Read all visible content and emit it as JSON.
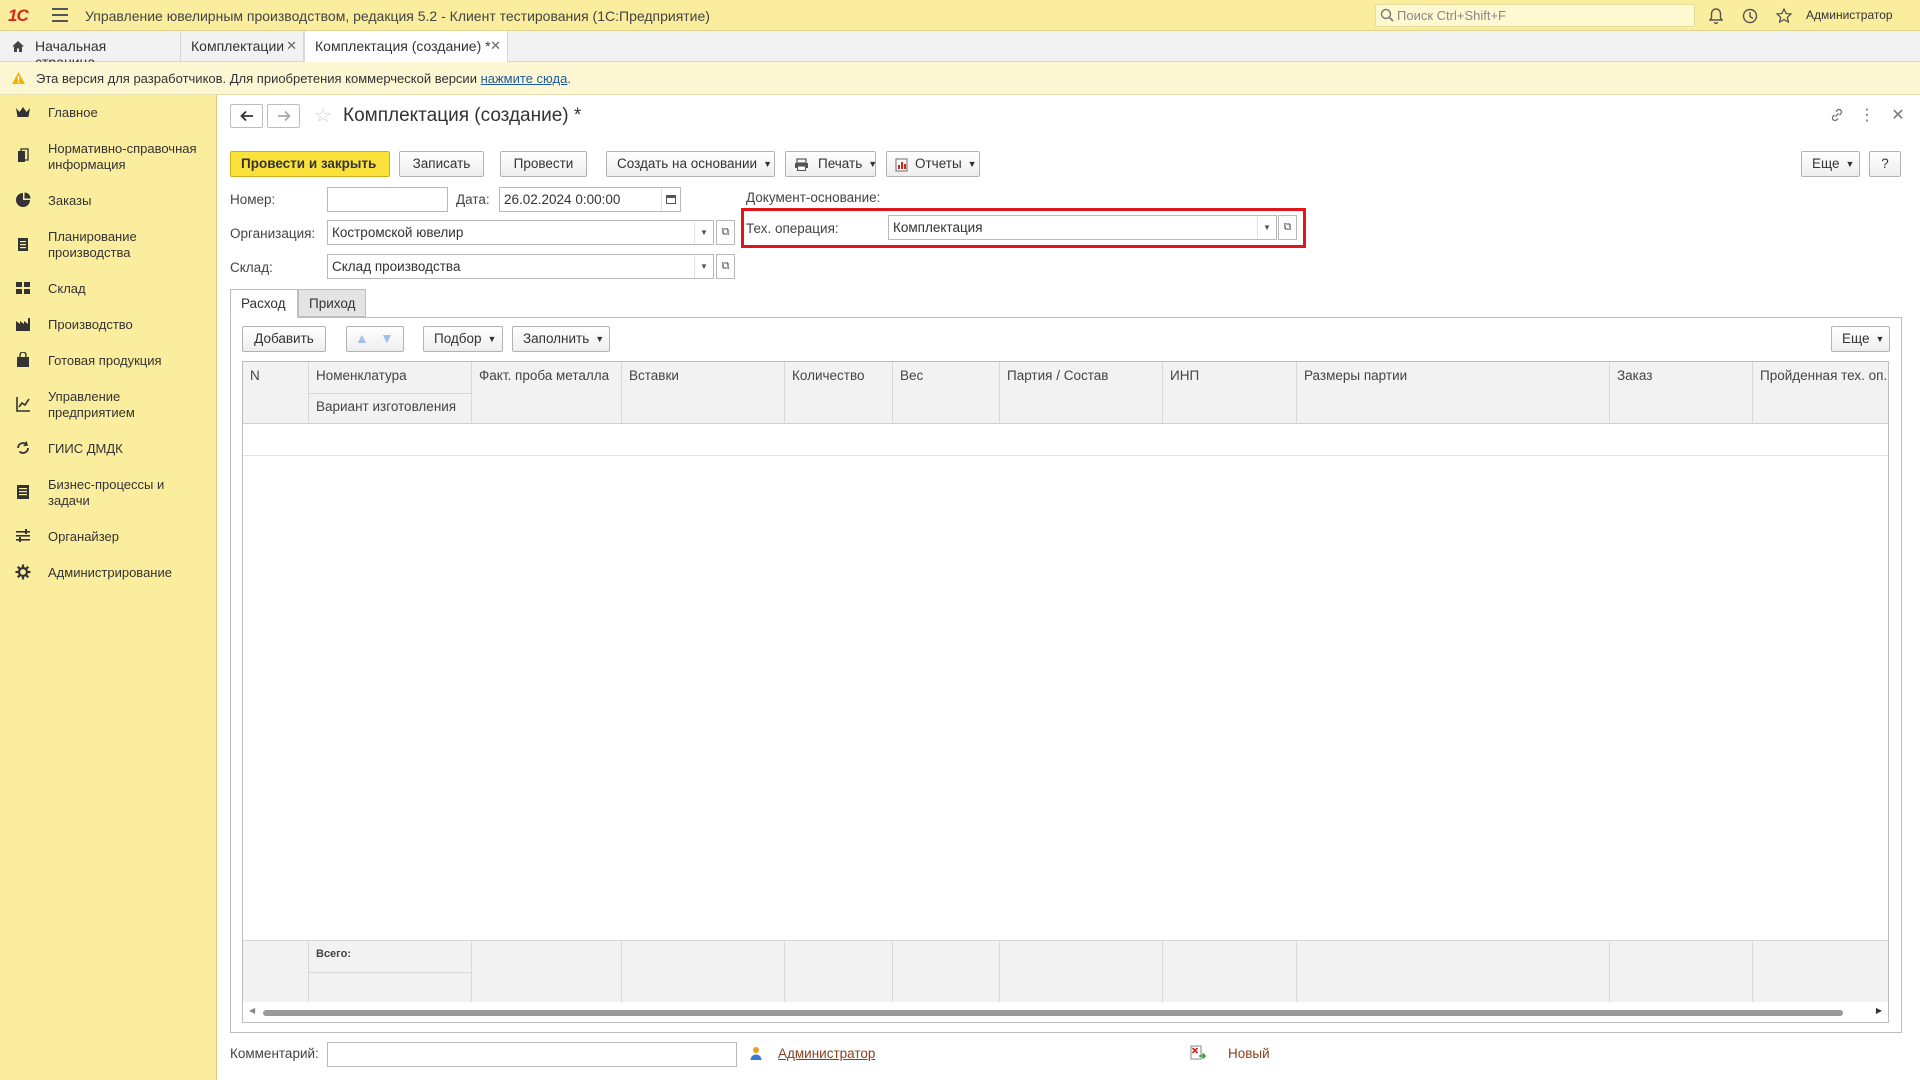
{
  "app": {
    "logo": "1С",
    "title": "Управление ювелирным производством, редакция 5.2  - Клиент тестирования (1С:Предприятие)",
    "search_placeholder": "Поиск Ctrl+Shift+F",
    "user": "Администратор"
  },
  "tabs": [
    {
      "label": "Начальная страница"
    },
    {
      "label": "Комплектации"
    },
    {
      "label": "Комплектация (создание) *"
    }
  ],
  "banner": {
    "text": "Эта версия для разработчиков. Для приобретения коммерческой версии ",
    "link": "нажмите сюда",
    "tail": "."
  },
  "sidebar": {
    "items": [
      {
        "label": "Главное",
        "icon": "crown-icon"
      },
      {
        "label": "Нормативно-справочная информация",
        "icon": "books-icon"
      },
      {
        "label": "Заказы",
        "icon": "pie-chart-icon"
      },
      {
        "label": "Планирование производства",
        "icon": "clipboard-icon"
      },
      {
        "label": "Склад",
        "icon": "grid-icon"
      },
      {
        "label": "Производство",
        "icon": "factory-icon"
      },
      {
        "label": "Готовая продукция",
        "icon": "bag-icon"
      },
      {
        "label": "Управление предприятием",
        "icon": "chart-icon"
      },
      {
        "label": "ГИИС ДМДК",
        "icon": "cycle-icon"
      },
      {
        "label": "Бизнес-процессы и задачи",
        "icon": "tasks-icon"
      },
      {
        "label": "Органайзер",
        "icon": "organizer-icon"
      },
      {
        "label": "Администрирование",
        "icon": "gear-icon"
      }
    ]
  },
  "form": {
    "title": "Комплектация (создание) *",
    "toolbar": {
      "post_close": "Провести и закрыть",
      "save": "Записать",
      "post": "Провести",
      "create_based": "Создать на основании",
      "print": "Печать",
      "reports": "Отчеты",
      "more": "Еще",
      "help": "?"
    },
    "fields": {
      "number_label": "Номер:",
      "number_value": "",
      "date_label": "Дата:",
      "date_value": "26.02.2024  0:00:00",
      "org_label": "Организация:",
      "org_value": "Костромской ювелир",
      "warehouse_label": "Склад:",
      "warehouse_value": "Склад производства",
      "base_doc_label": "Документ-основание:",
      "tech_op_label": "Тех. операция:",
      "tech_op_value": "Комплектация"
    },
    "section_tabs": [
      "Расход",
      "Приход"
    ],
    "table_toolbar": {
      "add": "Добавить",
      "pick": "Подбор",
      "fill": "Заполнить",
      "more": "Еще"
    },
    "columns": {
      "n": "N",
      "nomenclature": "Номенклатура",
      "variant": "Вариант изготовления",
      "metal": "Факт. проба металла",
      "inserts": "Вставки",
      "qty": "Количество",
      "weight": "Вес",
      "batch": "Партия / Состав",
      "inp": "ИНП",
      "batch_sizes": "Размеры партии",
      "order": "Заказ",
      "passed_op": "Пройденная тех. оп..."
    },
    "footer": {
      "total": "Всего:"
    },
    "bottom": {
      "comment_label": "Комментарий:",
      "author": "Администратор",
      "status": "Новый"
    }
  }
}
